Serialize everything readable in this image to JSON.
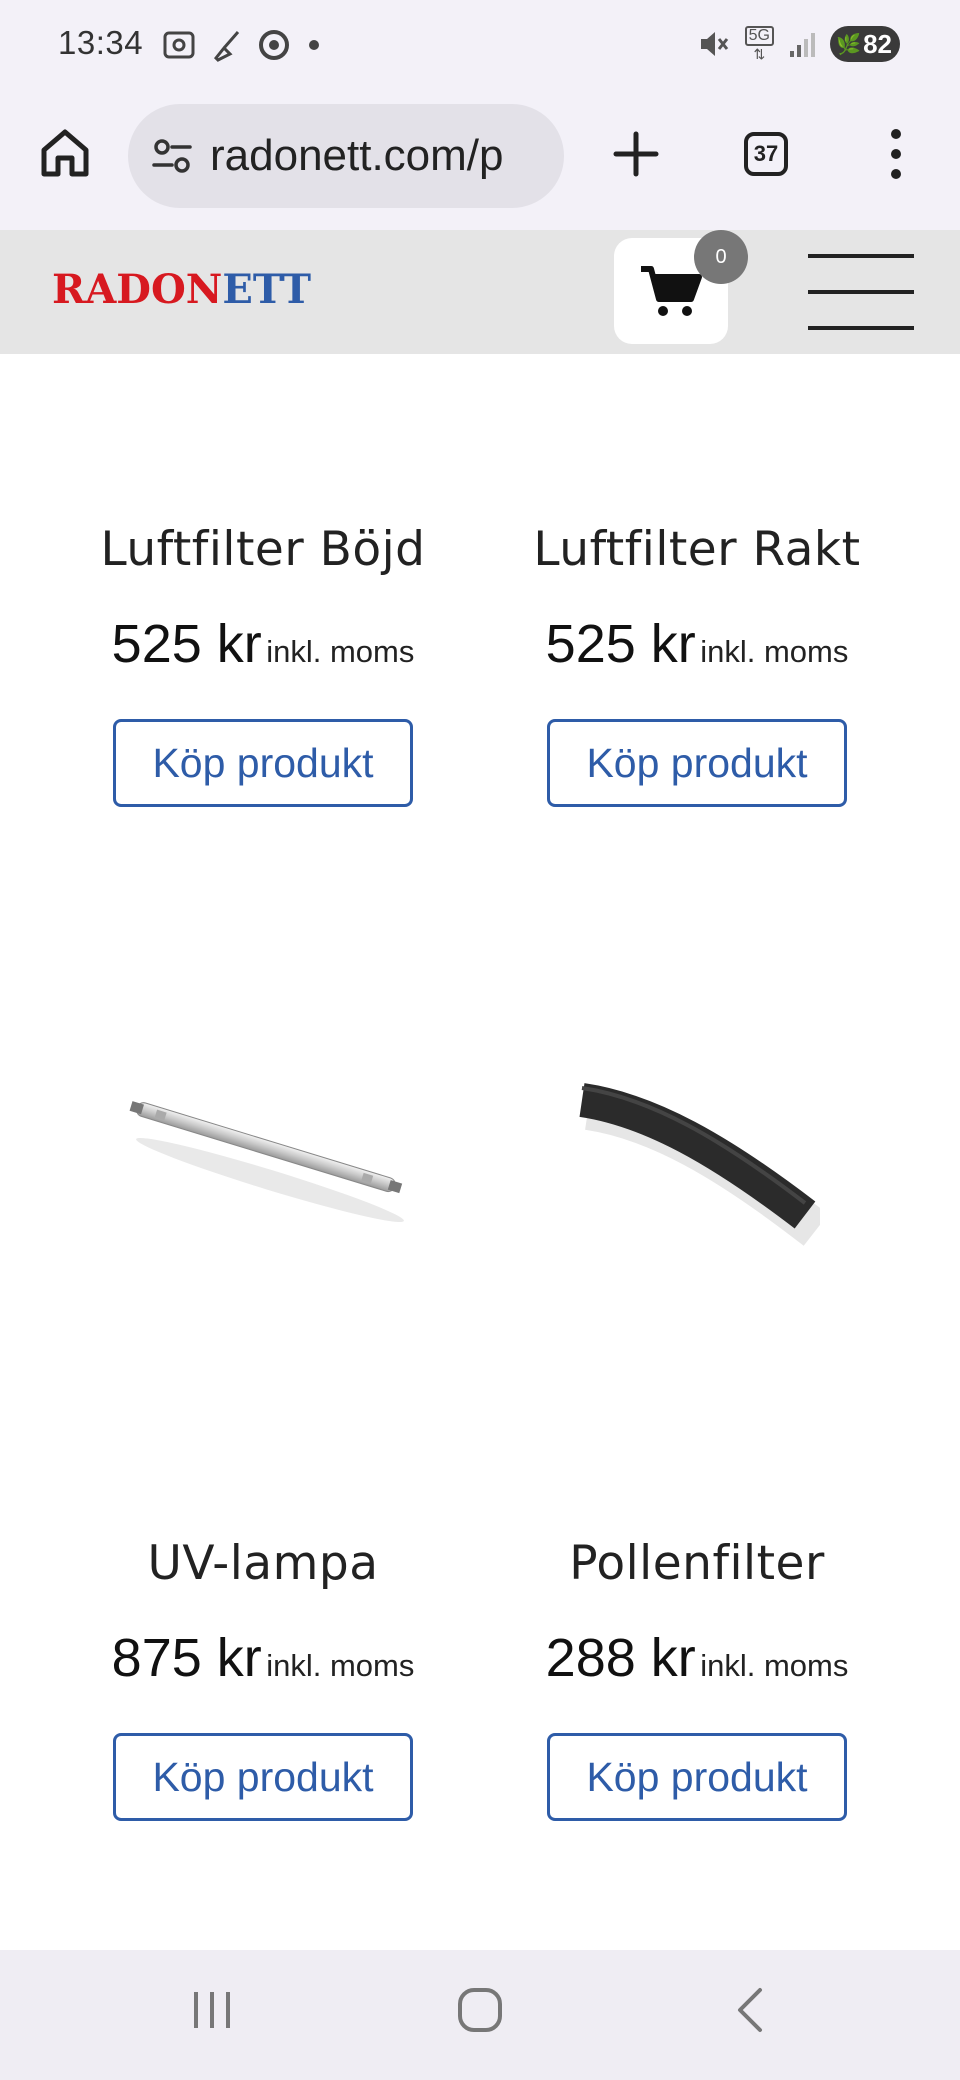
{
  "status_bar": {
    "time": "13:34",
    "network": "5G",
    "battery": "82",
    "icons_left": [
      "screenshot-icon",
      "broom-icon",
      "chrome-icon",
      "dot-icon"
    ],
    "icons_right": [
      "mute-icon",
      "5g-icon",
      "signal-icon",
      "battery-icon"
    ]
  },
  "browser": {
    "url": "radonett.com/p",
    "tab_count": "37"
  },
  "site_header": {
    "logo_part1": "RADON",
    "logo_part2": "ETT",
    "cart_count": "0"
  },
  "products": [
    {
      "name": "Luftfilter Böjd",
      "price": "525 kr",
      "price_suffix": "inkl. moms",
      "button": "Köp produkt"
    },
    {
      "name": "Luftfilter Rakt",
      "price": "525 kr",
      "price_suffix": "inkl. moms",
      "button": "Köp produkt"
    },
    {
      "name": "UV-lampa",
      "price": "875 kr",
      "price_suffix": "inkl. moms",
      "button": "Köp produkt"
    },
    {
      "name": "Pollenfilter",
      "price": "288 kr",
      "price_suffix": "inkl. moms",
      "button": "Köp produkt"
    }
  ],
  "colors": {
    "logo_red": "#d71920",
    "logo_blue": "#2e5ca8",
    "button_blue": "#2e5ca8"
  }
}
